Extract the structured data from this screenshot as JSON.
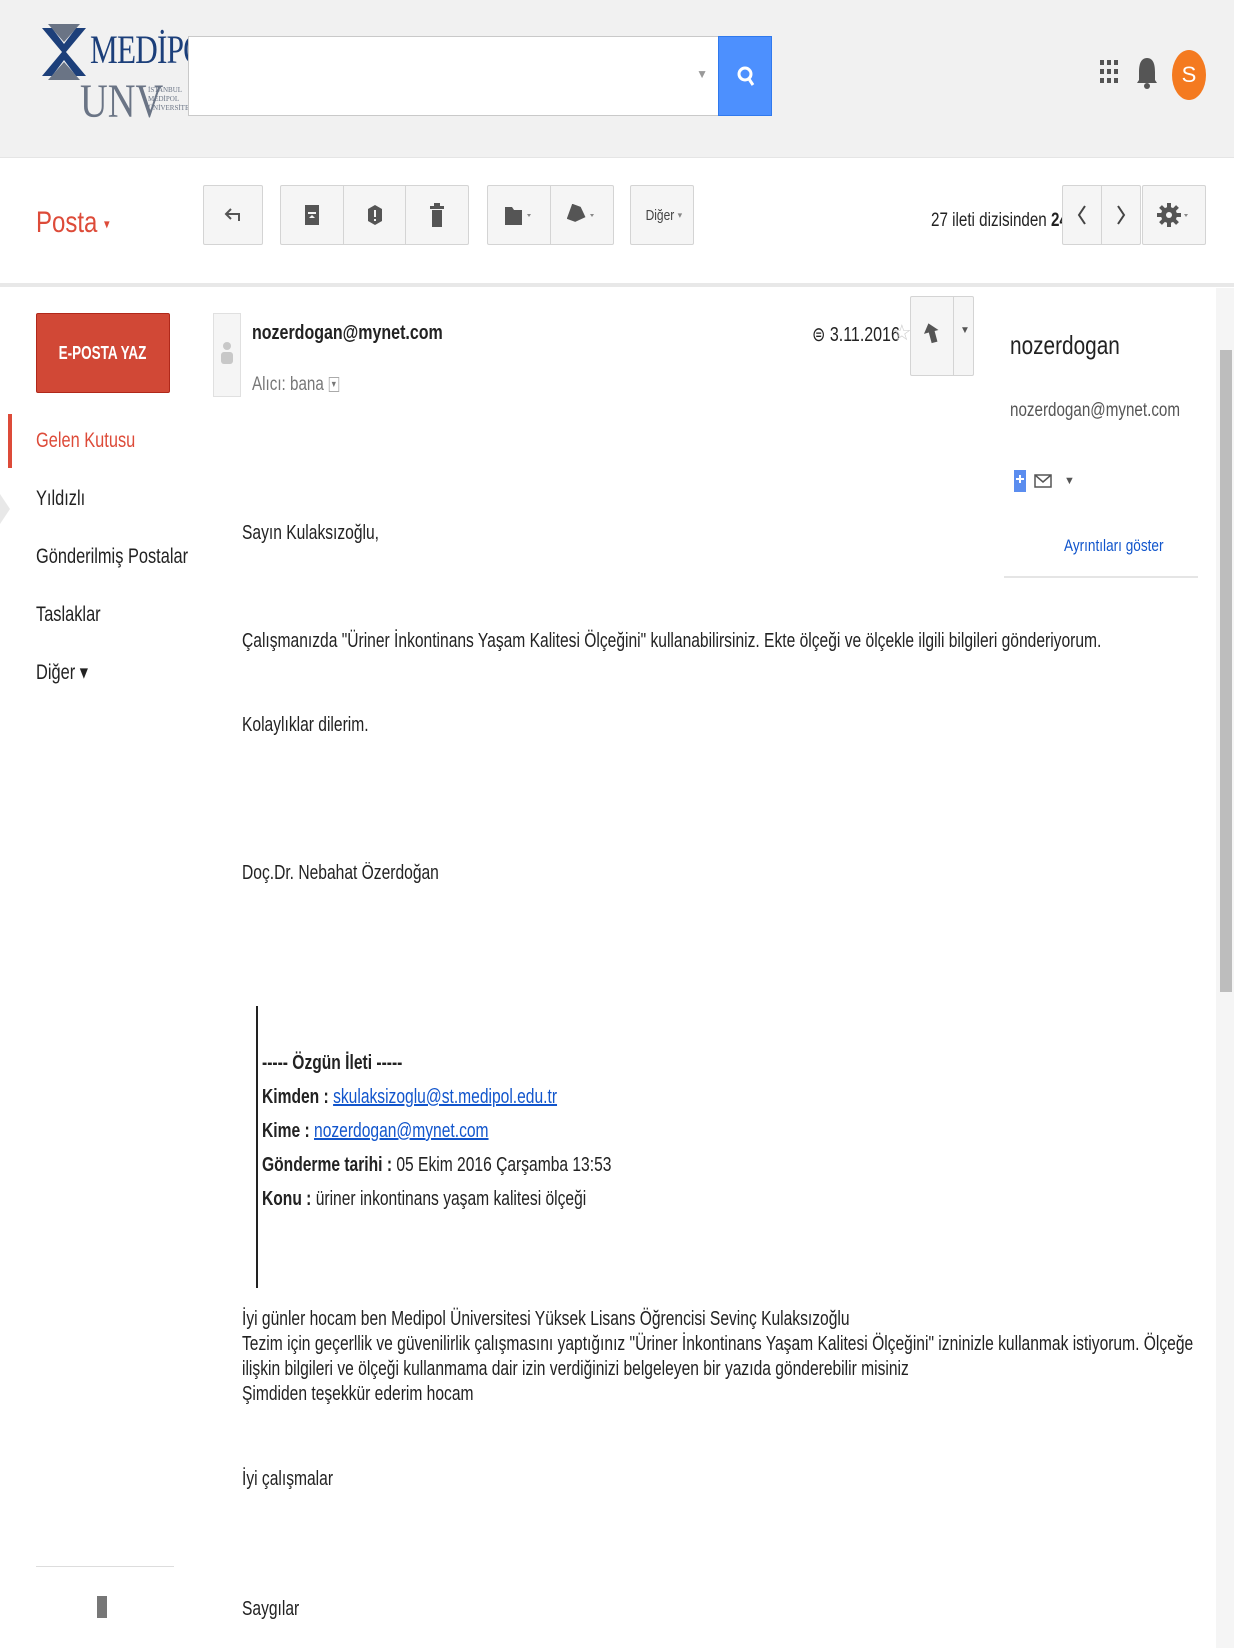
{
  "header": {
    "logo": {
      "wordmark": "MEDİPOL",
      "sub": "UNV",
      "tiny_lines": [
        "İSTANBUL",
        "MEDİPOL",
        "ÜNİVERSİTESİ"
      ]
    },
    "search": {
      "value": "",
      "placeholder": ""
    },
    "avatar_letter": "S",
    "accent_color": "#dd4b39",
    "search_button_color": "#4d90fe",
    "avatar_color": "#f47a20",
    "icons": [
      "search-icon",
      "apps-grid-icon",
      "notification-bell-icon"
    ]
  },
  "toolbar": {
    "mail_label": "Posta",
    "more_label": "Diğer",
    "counter_prefix": "27 ileti dizisinden",
    "counter_value": "24.",
    "icons": [
      "back-arrow-icon",
      "archive-icon",
      "report-spam-icon",
      "delete-trash-icon",
      "folder-move-icon",
      "label-tag-icon",
      "chevron-left-icon",
      "chevron-right-icon",
      "settings-gear-icon"
    ]
  },
  "sidebar": {
    "compose_label": "E-POSTA YAZ",
    "items": [
      {
        "label": "Gelen Kutusu",
        "active": true
      },
      {
        "label": "Yıldızlı",
        "active": false
      },
      {
        "label": "Gönderilmiş Postalar",
        "active": false
      },
      {
        "label": "Taslaklar",
        "active": false
      },
      {
        "label": "Diğer ▾",
        "active": false
      }
    ]
  },
  "message": {
    "sender": "nozerdogan@mynet.com",
    "to_label": "Alıcı: bana",
    "date": "3.11.2016",
    "greeting": "Sayın Kulaksızoğlu,",
    "paragraph1": "Çalışmanızda \"Üriner İnkontinans Yaşam Kalitesi Ölçeğini\" kullanabilirsiniz. Ekte ölçeği ve ölçekle ilgili bilgileri gönderiyorum.",
    "paragraph2": "Kolaylıklar dilerim.",
    "signature": "Doç.Dr. Nebahat Özerdoğan",
    "quoted": {
      "title": "----- Özgün İleti -----",
      "from_label": "Kimden :",
      "from_value": "skulaksizoglu@st.medipol.edu.tr",
      "to_label": "Kime :",
      "to_value": "nozerdogan@mynet.com",
      "sent_label": "Gönderme tarihi :",
      "sent_value": "05 Ekim 2016 Çarşamba 13:53",
      "subject_label": "Konu :",
      "subject_value": "üriner inkontinans yaşam kalitesi ölçeği"
    },
    "original_lines": [
      "İyi günler hocam ben Medipol Üniversitesi Yüksek Lisans Öğrencisi Sevinç Kulaksızoğlu",
      "Tezim için geçerllik ve güvenilirlik çalışmasını yaptığınız \"Üriner İnkontinans Yaşam Kalitesi Ölçeğini\" izninizle kullanmak istiyorum. Ölçeğe",
      "ilişkin bilgileri ve ölçeği kullanmama dair izin verdiğinizi belgeleyen bir yazıda gönderebilir misiniz",
      "Şimdiden teşekkür ederim hocam"
    ],
    "closing1": "İyi çalışmalar",
    "closing2": "Saygılar"
  },
  "contact": {
    "name": "nozerdogan",
    "email": "nozerdogan@mynet.com",
    "details_link": "Ayrıntıları göster"
  }
}
